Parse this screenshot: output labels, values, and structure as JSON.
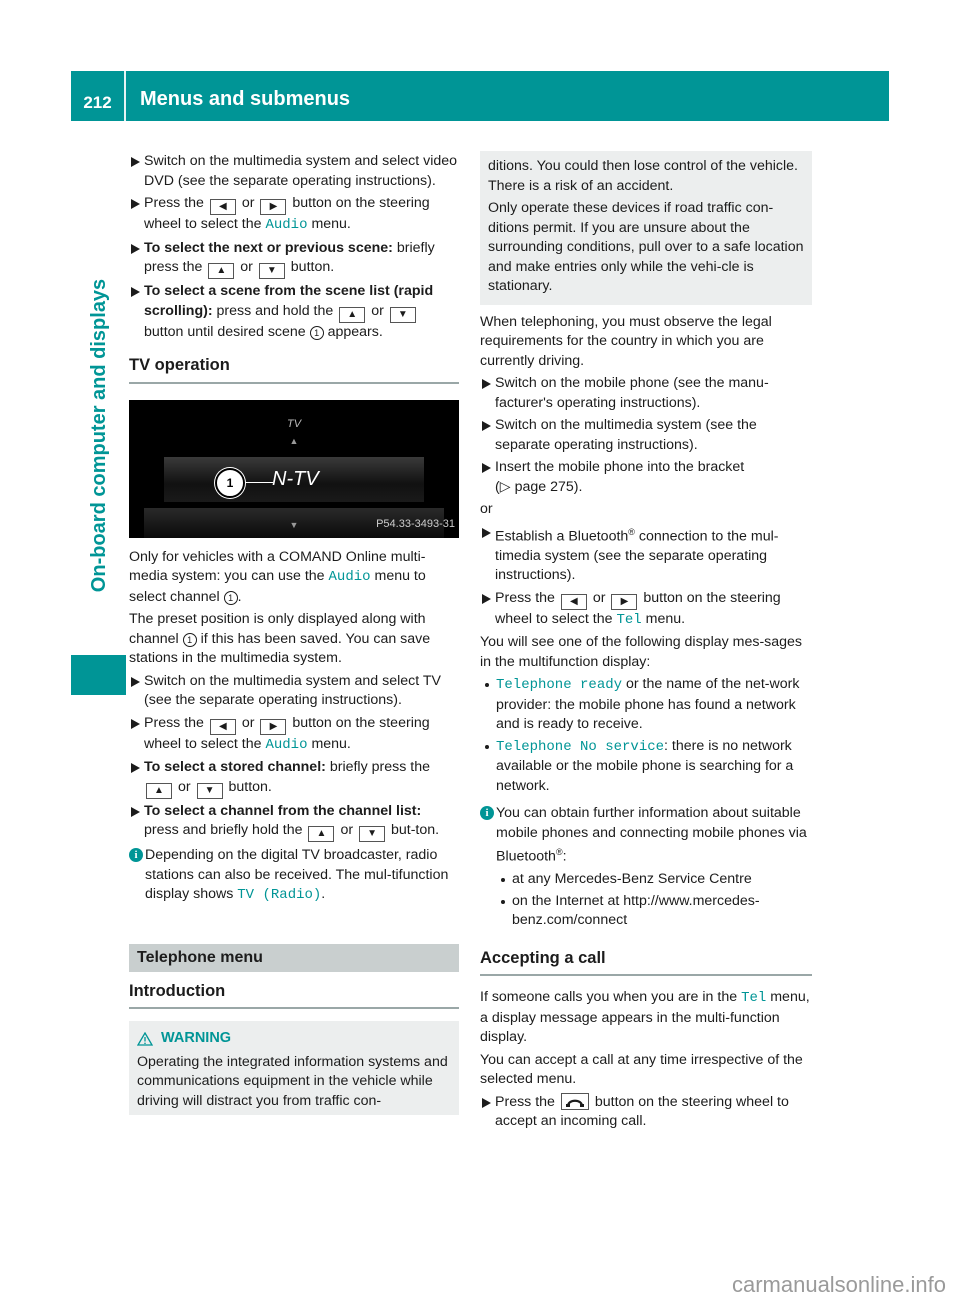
{
  "header": {
    "page_number": "212",
    "title": "Menus and submenus"
  },
  "side_tab": {
    "label": "On-board computer and displays"
  },
  "left_column": {
    "steps_dvd": [
      {
        "text": "Switch on the multimedia system and select video DVD (see the separate operating instructions)."
      },
      {
        "pre": "Press the",
        "key1": "◀",
        "mid": "or",
        "key2": "▶",
        "post": "button on the steering wheel to select the",
        "menu": "Audio",
        "end": "menu."
      },
      {
        "bold": "To select the next or previous scene:",
        "pre": "briefly press the",
        "key1": "▲",
        "mid": "or",
        "key2": "▼",
        "post": "button."
      },
      {
        "bold": "To select a scene from the scene list (rapid scrolling):",
        "pre": "press and hold the",
        "key1": "▲",
        "mid": "or",
        "key2": "▼",
        "post": "button until desired scene",
        "callout": "1",
        "end": "appears."
      }
    ],
    "tv_heading": "TV operation",
    "tv_image": {
      "title": "TV",
      "up_arrow": "▲",
      "down_arrow": "▼",
      "callout": "1",
      "channel": "N-TV",
      "code": "P54.33-3493-31"
    },
    "tv_para1": {
      "pre": "Only for vehicles with a COMAND Online multi-media system: you can use the",
      "menu": "Audio",
      "post": "menu to select channel",
      "callout": "1",
      "end": "."
    },
    "tv_para2": {
      "pre": "The preset position is only displayed along with channel",
      "callout": "1",
      "post": "if this has been saved. You can save stations in the multimedia system."
    },
    "steps_tv": [
      {
        "text": "Switch on the multimedia system and select TV (see the separate operating instructions)."
      },
      {
        "pre": "Press the",
        "key1": "◀",
        "mid": "or",
        "key2": "▶",
        "post": "button on the steering wheel to select the",
        "menu": "Audio",
        "end": "menu."
      },
      {
        "bold": "To select a stored channel:",
        "pre": "briefly press the",
        "key1": "▲",
        "mid": "or",
        "key2": "▼",
        "post": "button."
      },
      {
        "bold": "To select a channel from the channel list:",
        "pre": "press and briefly hold the",
        "key1": "▲",
        "mid": "or",
        "key2": "▼",
        "post": "but-ton."
      }
    ],
    "info_tv": {
      "icon": "i",
      "pre": "Depending on the digital TV broadcaster, radio stations can also be received. The mul-tifunction display shows",
      "display": "TV (Radio)",
      "end": "."
    },
    "telephone_band": "Telephone menu",
    "intro_heading": "Introduction",
    "warning": {
      "title": "WARNING",
      "text": "Operating the integrated information systems and communications equipment in the vehicle while driving will distract you from traffic con-"
    }
  },
  "right_column": {
    "warning_cont": {
      "p1": "ditions. You could then lose control of the vehicle. There is a risk of an accident.",
      "p2": "Only operate these devices if road traffic con-ditions permit. If you are unsure about the surrounding conditions, pull over to a safe location and make entries only while the vehi-cle is stationary."
    },
    "legal_para": "When telephoning, you must observe the legal requirements for the country in which you are currently driving.",
    "steps_phone": [
      {
        "text": "Switch on the mobile phone (see the manu-facturer's operating instructions)."
      },
      {
        "text": "Switch on the multimedia system (see the separate operating instructions)."
      },
      {
        "text": "Insert the mobile phone into the bracket",
        "ref": "(▷ page 275)."
      }
    ],
    "or_label": "or",
    "steps_bt": [
      {
        "pre": "Establish a Bluetooth",
        "sup": "®",
        "post": "connection to the mul-timedia system (see the separate operating instructions)."
      },
      {
        "pre": "Press the",
        "key1": "◀",
        "mid": "or",
        "key2": "▶",
        "post": "button on the steering wheel to select the",
        "menu": "Tel",
        "end": "menu."
      }
    ],
    "display_intro": "You will see one of the following display mes-sages in the multifunction display:",
    "display_messages": [
      {
        "msg": "Telephone ready",
        "desc": "or the name of the net-work provider: the mobile phone has found a network and is ready to receive."
      },
      {
        "msg": "Telephone No service",
        "desc": ": there is no network available or the mobile phone is searching for a network."
      }
    ],
    "info_bt": {
      "icon": "i",
      "pre": "You can obtain further information about suitable mobile phones and connecting mobile phones via Bluetooth",
      "sup": "®",
      "end": ":"
    },
    "info_bt_bullets": [
      "at any Mercedes-Benz Service Centre",
      "on the Internet at http://www.mercedes-benz.com/connect"
    ],
    "accept_heading": "Accepting a call",
    "accept_para1": {
      "pre": "If someone calls you when you are in the",
      "menu": "Tel",
      "post": "menu, a display message appears in the multi-function display."
    },
    "accept_para2": "You can accept a call at any time irrespective of the selected menu.",
    "accept_step": {
      "pre": "Press the",
      "post": "button on the steering wheel to accept an incoming call."
    }
  },
  "watermark": "carmanualsonline.info"
}
